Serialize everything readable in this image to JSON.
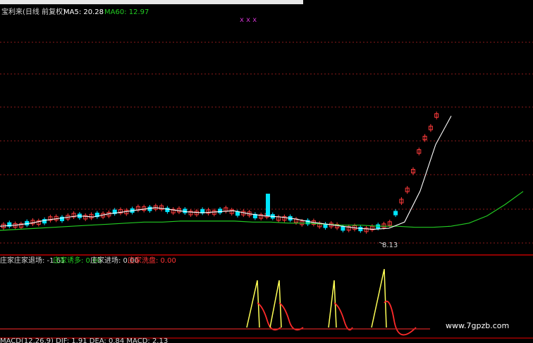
{
  "header": {
    "stock": "宝利来(日线 前复权)",
    "ma5_label": "MA5: 20.28",
    "ma60_label": "MA60: 12.97",
    "x_marks": "x     x x"
  },
  "indicator_header": {
    "name": "庄家",
    "items": [
      {
        "text": "庄家退场: -1.61",
        "color": "#d9d9d9"
      },
      {
        "text": "庄家诱多: 0.00",
        "color": "#22cc22"
      },
      {
        "text": "庄家进场: 0.00",
        "color": "#d9d9d9"
      },
      {
        "text": "庄家洗盘: 0.00",
        "color": "#ff3333"
      }
    ]
  },
  "macd_header": {
    "text": "MACD(12,26,9) DIF: 1.91 DEA: 0.84 MACD: 2.13"
  },
  "annotation": {
    "low_price": "8.13"
  },
  "watermark": "www.7gpzb.com",
  "colors": {
    "background": "#000000",
    "grid": "#8b1a1a",
    "separator": "#c00000",
    "up_candle": "#ff3b3b",
    "down_candle": "#00e5ff",
    "ma5": "#ffffff",
    "ma60": "#22cc22",
    "signal_yellow": "#ffff55",
    "signal_red": "#ff2a2a"
  },
  "chart_data": [
    {
      "type": "candlestick",
      "title": "宝利来(日线 前复权)",
      "series": [
        {
          "name": "MA5",
          "values": [
            9.6,
            9.7,
            9.9,
            10.2,
            10.4,
            10.6,
            10.5,
            10.8,
            11.0,
            11.2,
            11.4,
            11.2,
            11.0,
            10.9,
            11.0,
            11.1,
            10.8,
            10.6,
            10.5,
            10.3,
            10.0,
            9.8,
            9.6,
            9.4,
            9.3,
            9.4,
            10.0,
            13.0,
            17.5,
            20.28
          ]
        },
        {
          "name": "MA60",
          "values": [
            9.2,
            9.3,
            9.4,
            9.5,
            9.6,
            9.7,
            9.8,
            9.9,
            10.0,
            10.0,
            10.1,
            10.1,
            10.1,
            10.1,
            10.0,
            10.0,
            9.9,
            9.9,
            9.8,
            9.7,
            9.7,
            9.6,
            9.6,
            9.5,
            9.5,
            9.6,
            9.9,
            10.6,
            11.7,
            12.97
          ]
        }
      ],
      "low_annotation": 8.13
    },
    {
      "type": "line",
      "title": "庄家",
      "series": [
        {
          "name": "庄家退场",
          "values": [
            0,
            0,
            0,
            0,
            0,
            0,
            0,
            0,
            0,
            -1.61
          ]
        },
        {
          "name": "庄家诱多",
          "values": [
            0,
            0,
            0,
            0,
            0,
            0,
            0,
            0,
            0,
            0
          ]
        },
        {
          "name": "庄家进场",
          "values": [
            0,
            0,
            0,
            0,
            0,
            0,
            0,
            0,
            0,
            0
          ]
        },
        {
          "name": "庄家洗盘",
          "values": [
            0,
            0,
            0,
            0,
            0,
            0,
            0,
            0,
            0,
            0
          ]
        }
      ]
    }
  ]
}
